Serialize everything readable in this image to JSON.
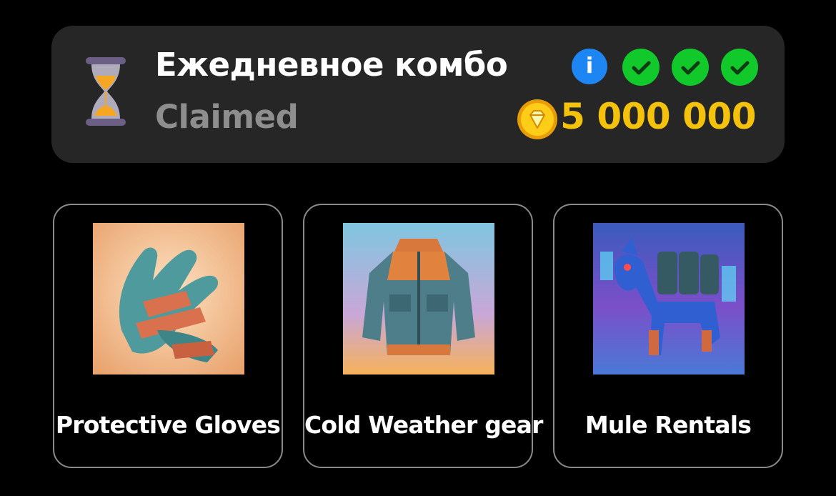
{
  "combo": {
    "title": "Ежедневное комбо",
    "status": "Claimed",
    "reward": "5 000 000",
    "info_icon": "i",
    "checks": [
      true,
      true,
      true
    ]
  },
  "items": [
    {
      "label": "Protective Gloves",
      "image": "gloves-image"
    },
    {
      "label": "Cold Weather gear",
      "image": "jacket-image"
    },
    {
      "label": "Mule Rentals",
      "image": "mule-image"
    }
  ],
  "colors": {
    "card_bg": "#262626",
    "status_gray": "#8e8e8e",
    "reward_gold": "#f4c20d",
    "check_green": "#12c92c",
    "info_blue": "#1e86f3"
  },
  "icons": [
    "hourglass-icon",
    "info-icon",
    "check-icon",
    "coin-icon"
  ]
}
